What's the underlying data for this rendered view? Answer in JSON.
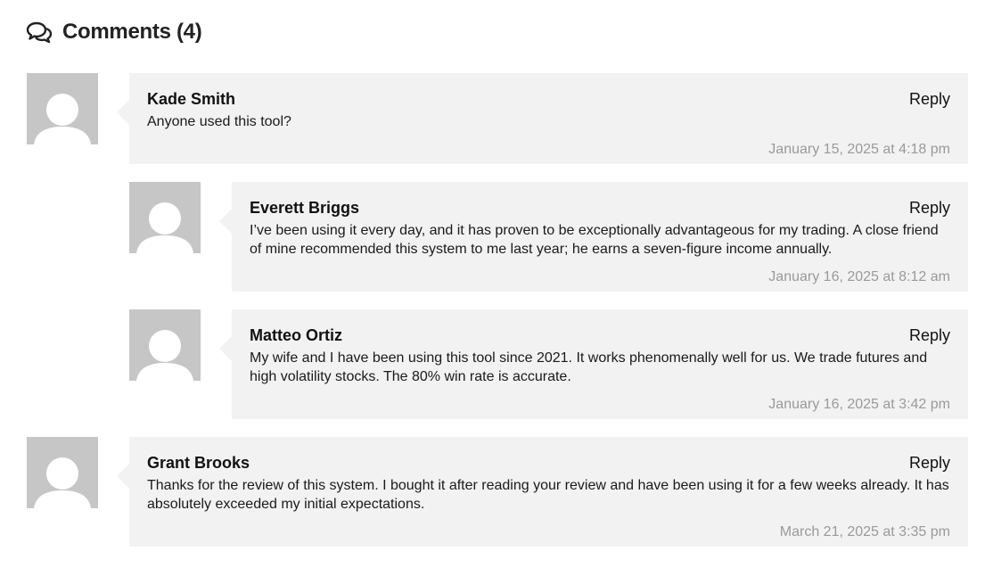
{
  "header": {
    "title": "Comments (4)",
    "icon": "comments-icon"
  },
  "comments": [
    {
      "author": "Kade Smith",
      "reply_label": "Reply",
      "text": "Anyone used this tool?",
      "date": "January 15, 2025 at 4:18 pm"
    },
    {
      "author": "Everett Briggs",
      "reply_label": "Reply",
      "text": "I’ve been using it every day, and it has proven to be exceptionally advantageous for my trading. A close friend of mine recommended this system to me last year; he earns a seven-figure income annually.",
      "date": "January 16, 2025 at 8:12 am"
    },
    {
      "author": "Matteo Ortiz",
      "reply_label": "Reply",
      "text": "My wife and I have been using this tool since 2021. It works phenomenally well for us. We trade futures and high volatility stocks. The 80% win rate is accurate.",
      "date": "January 16, 2025 at 3:42 pm"
    },
    {
      "author": "Grant Brooks",
      "reply_label": "Reply",
      "text": "Thanks for the review of this system. I bought it after reading your review and have been using it for a few weeks already. It has absolutely exceeded my initial expectations.",
      "date": "March 21, 2025 at 3:35 pm"
    }
  ],
  "colors": {
    "bubble_background": "#f2f2f2",
    "avatar_placeholder": "#c6c6c6",
    "date_text": "#9a9a9a"
  }
}
